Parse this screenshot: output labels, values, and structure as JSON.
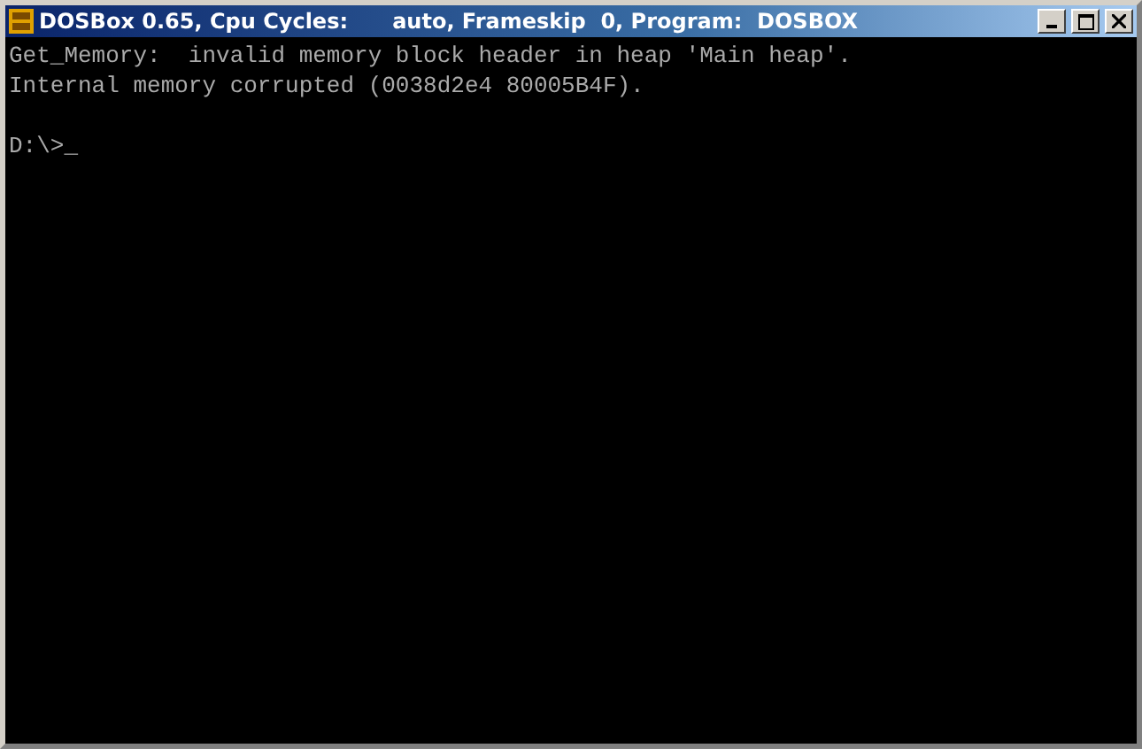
{
  "window": {
    "title": "DOSBox 0.65, Cpu Cycles:      auto, Frameskip  0, Program:  DOSBOX",
    "controls": [
      {
        "kind": "minimize"
      },
      {
        "kind": "maximize"
      },
      {
        "kind": "close"
      }
    ]
  },
  "console": {
    "lines": [
      "Get_Memory:  invalid memory block header in heap 'Main heap'.",
      "Internal memory corrupted (0038d2e4 80005B4F)."
    ],
    "prompt": "D:\\>",
    "cursor": "_"
  }
}
